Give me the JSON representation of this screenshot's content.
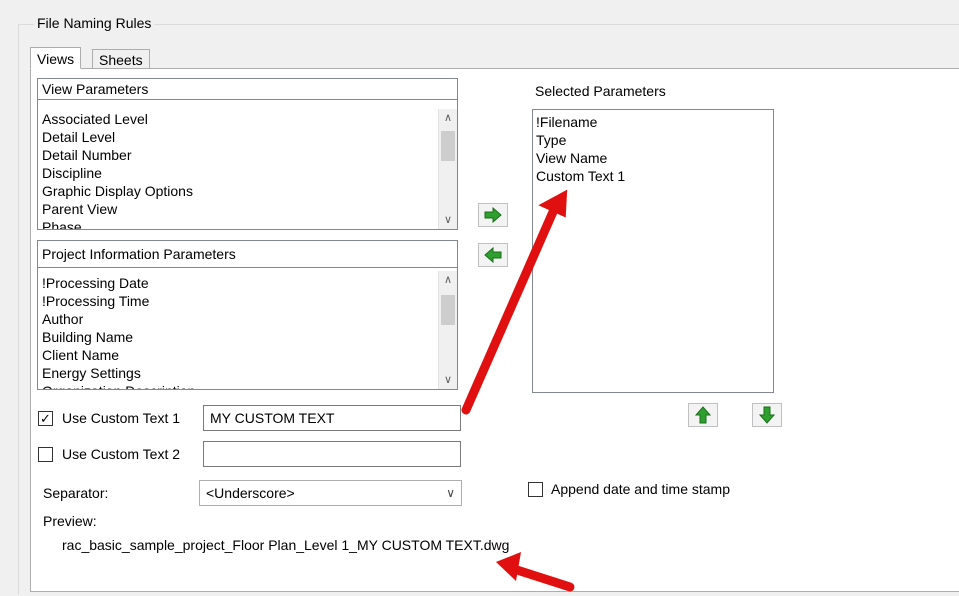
{
  "group": {
    "title": "File Naming Rules"
  },
  "tabs": [
    {
      "label": "Views",
      "active": true
    },
    {
      "label": "Sheets",
      "active": false
    }
  ],
  "view_parameters": {
    "header": "View Parameters",
    "items": [
      "Associated Level",
      "Detail Level",
      "Detail Number",
      "Discipline",
      "Graphic Display Options",
      "Parent View",
      "Phase"
    ]
  },
  "project_parameters": {
    "header": "Project Information Parameters",
    "items": [
      "!Processing Date",
      "!Processing Time",
      "Author",
      "Building Name",
      "Client Name",
      "Energy Settings",
      "Organization Description"
    ]
  },
  "selected_parameters": {
    "header": "Selected Parameters",
    "items": [
      "!Filename",
      "Type",
      "View Name",
      "Custom Text 1"
    ]
  },
  "custom_text_1": {
    "label": "Use Custom Text 1",
    "checked": true,
    "value": "MY CUSTOM TEXT"
  },
  "custom_text_2": {
    "label": "Use Custom Text 2",
    "checked": false,
    "value": ""
  },
  "separator": {
    "label": "Separator:",
    "value": "<Underscore>"
  },
  "append_stamp": {
    "label": "Append date and time stamp",
    "checked": false
  },
  "preview": {
    "label": "Preview:",
    "value": "rac_basic_sample_project_Floor Plan_Level 1_MY CUSTOM TEXT.dwg"
  },
  "colors": {
    "arrow_green": "#2fa02f",
    "annotation_red": "#e01010"
  },
  "icons": {
    "add": "arrow-right-icon",
    "remove": "arrow-left-icon",
    "move_up": "arrow-up-icon",
    "move_down": "arrow-down-icon"
  }
}
